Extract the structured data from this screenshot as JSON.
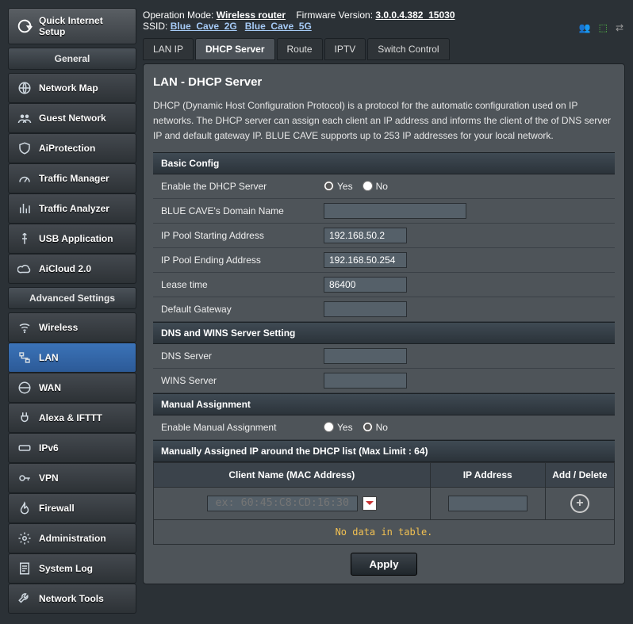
{
  "header": {
    "op_mode_label": "Operation Mode:",
    "op_mode_value": "Wireless router",
    "fw_label": "Firmware Version:",
    "fw_value": "3.0.0.4.382_15030",
    "ssid_label": "SSID:",
    "ssid_2g": "Blue_Cave_2G",
    "ssid_5g": "Blue_Cave_5G"
  },
  "qis": {
    "line1": "Quick Internet",
    "line2": "Setup"
  },
  "sidebar": {
    "general_label": "General",
    "advanced_label": "Advanced Settings",
    "general": [
      {
        "label": "Network Map",
        "icon": "globe"
      },
      {
        "label": "Guest Network",
        "icon": "group"
      },
      {
        "label": "AiProtection",
        "icon": "shield"
      },
      {
        "label": "Traffic Manager",
        "icon": "gauge"
      },
      {
        "label": "Traffic Analyzer",
        "icon": "bars"
      },
      {
        "label": "USB Application",
        "icon": "usb"
      },
      {
        "label": "AiCloud 2.0",
        "icon": "cloud"
      }
    ],
    "advanced": [
      {
        "label": "Wireless",
        "icon": "wifi"
      },
      {
        "label": "LAN",
        "icon": "lan",
        "active": true
      },
      {
        "label": "WAN",
        "icon": "globe2"
      },
      {
        "label": "Alexa & IFTTT",
        "icon": "plug"
      },
      {
        "label": "IPv6",
        "icon": "ipv6"
      },
      {
        "label": "VPN",
        "icon": "key"
      },
      {
        "label": "Firewall",
        "icon": "fire"
      },
      {
        "label": "Administration",
        "icon": "gear"
      },
      {
        "label": "System Log",
        "icon": "log"
      },
      {
        "label": "Network Tools",
        "icon": "tools"
      }
    ]
  },
  "tabs": [
    {
      "label": "LAN IP"
    },
    {
      "label": "DHCP Server",
      "active": true
    },
    {
      "label": "Route"
    },
    {
      "label": "IPTV"
    },
    {
      "label": "Switch Control"
    }
  ],
  "page": {
    "title": "LAN - DHCP Server",
    "desc": "DHCP (Dynamic Host Configuration Protocol) is a protocol for the automatic configuration used on IP networks. The DHCP server can assign each client an IP address and informs the client of the of DNS server IP and default gateway IP. BLUE CAVE supports up to 253 IP addresses for your local network.",
    "sections": {
      "basic": {
        "title": "Basic Config",
        "rows": {
          "enable_label": "Enable the DHCP Server",
          "yes": "Yes",
          "no": "No",
          "domain_label": "BLUE CAVE's Domain Name",
          "domain_value": "",
          "pool_start_label": "IP Pool Starting Address",
          "pool_start_value": "192.168.50.2",
          "pool_end_label": "IP Pool Ending Address",
          "pool_end_value": "192.168.50.254",
          "lease_label": "Lease time",
          "lease_value": "86400",
          "gateway_label": "Default Gateway",
          "gateway_value": ""
        }
      },
      "dns": {
        "title": "DNS and WINS Server Setting",
        "rows": {
          "dns_label": "DNS Server",
          "dns_value": "",
          "wins_label": "WINS Server",
          "wins_value": ""
        }
      },
      "manual": {
        "title": "Manual Assignment",
        "rows": {
          "enable_label": "Enable Manual Assignment",
          "yes": "Yes",
          "no": "No"
        }
      },
      "list": {
        "title": "Manually Assigned IP around the DHCP list (Max Limit : 64)",
        "cols": {
          "client": "Client Name (MAC Address)",
          "ip": "IP Address",
          "add": "Add / Delete"
        },
        "mac_placeholder": "ex: 60:45:C8:CD:16:30",
        "empty": "No data in table."
      }
    },
    "apply": "Apply"
  }
}
